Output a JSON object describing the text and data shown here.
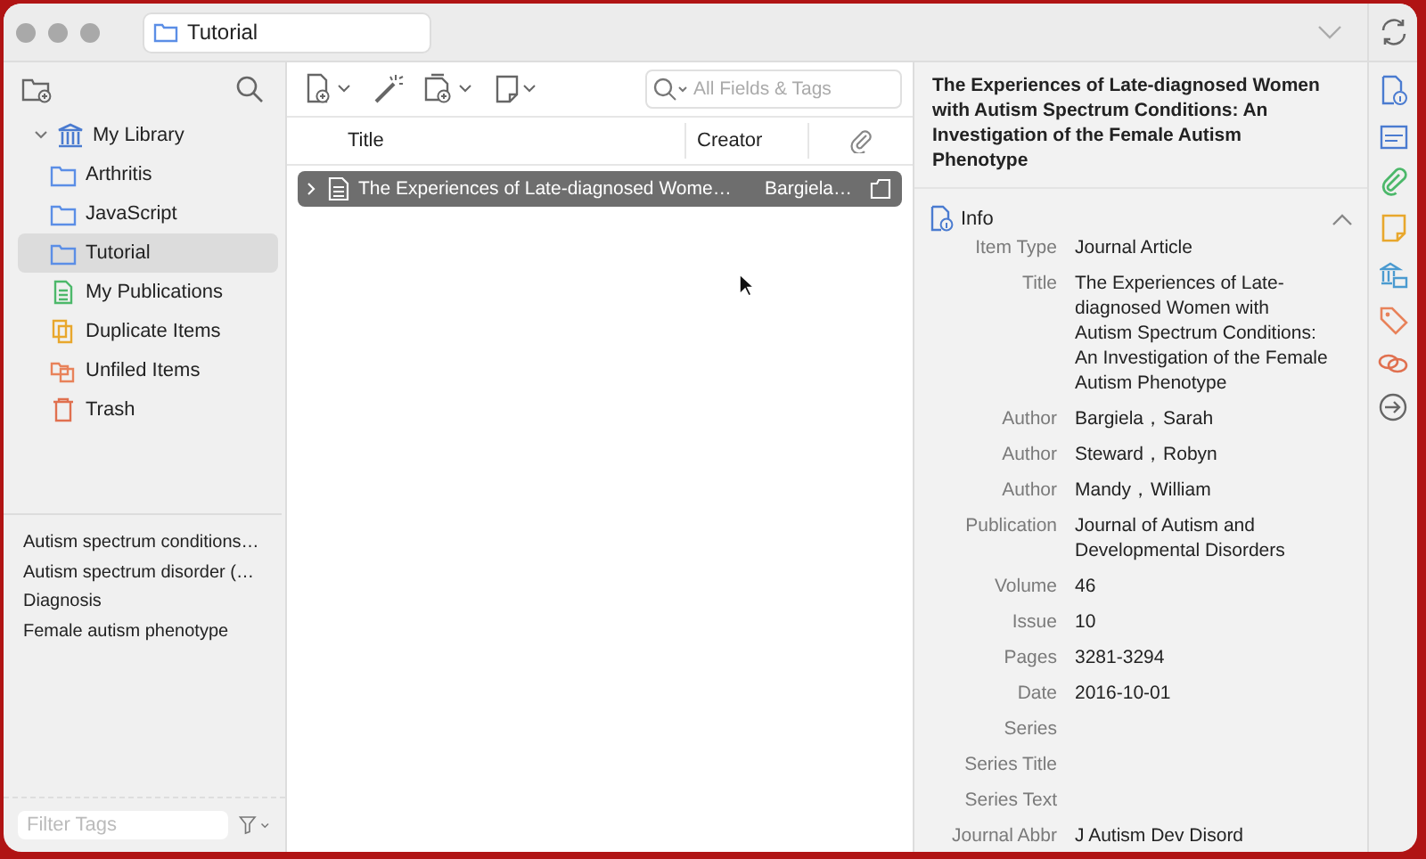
{
  "window": {
    "tab_title": "Tutorial"
  },
  "collections": [
    {
      "label": "My Library",
      "kind": "library",
      "expanded": true,
      "selected": false,
      "children": [
        {
          "label": "Arthritis",
          "kind": "folder",
          "selected": false
        },
        {
          "label": "JavaScript",
          "kind": "folder",
          "selected": false
        },
        {
          "label": "Tutorial",
          "kind": "folder",
          "selected": true
        },
        {
          "label": "My Publications",
          "kind": "publications",
          "selected": false
        },
        {
          "label": "Duplicate Items",
          "kind": "duplicates",
          "selected": false
        },
        {
          "label": "Unfiled Items",
          "kind": "unfiled",
          "selected": false
        },
        {
          "label": "Trash",
          "kind": "trash",
          "selected": false
        }
      ]
    }
  ],
  "tags": [
    "Autism spectrum conditions…",
    "Autism spectrum disorder (…",
    "Diagnosis",
    "Female autism phenotype"
  ],
  "tag_filter": {
    "placeholder": "Filter Tags"
  },
  "search": {
    "placeholder": "All Fields & Tags"
  },
  "table": {
    "columns": [
      "Title",
      "Creator"
    ],
    "rows": [
      {
        "title": "The Experiences of Late-diagnosed Wome…",
        "creator": "Bargiela…",
        "selected": true,
        "expanded": false
      }
    ]
  },
  "item_pane": {
    "title": "The Experiences of Late-diagnosed Women with Autism Spectrum Conditions: An Investigation of the Female Autism Phenotype",
    "section": {
      "label": "Info",
      "expanded": true
    },
    "fields": [
      {
        "label": "Item Type",
        "value": "Journal Article"
      },
      {
        "label": "Title",
        "value": "The Experiences of Late-diagnosed Women with Autism Spectrum Conditions: An Investigation of the Female Autism Phenotype"
      },
      {
        "label": "Author",
        "value": "Bargiela，Sarah"
      },
      {
        "label": "Author",
        "value": "Steward，Robyn"
      },
      {
        "label": "Author",
        "value": "Mandy，William"
      },
      {
        "label": "Publication",
        "value": "Journal of Autism and Developmental Disorders"
      },
      {
        "label": "Volume",
        "value": "46"
      },
      {
        "label": "Issue",
        "value": "10"
      },
      {
        "label": "Pages",
        "value": "3281-3294"
      },
      {
        "label": "Date",
        "value": "2016-10-01"
      },
      {
        "label": "Series"
      },
      {
        "label": "Series Title"
      },
      {
        "label": "Series Text"
      },
      {
        "label": "Journal Abbr",
        "value": "J Autism Dev Disord"
      }
    ]
  }
}
